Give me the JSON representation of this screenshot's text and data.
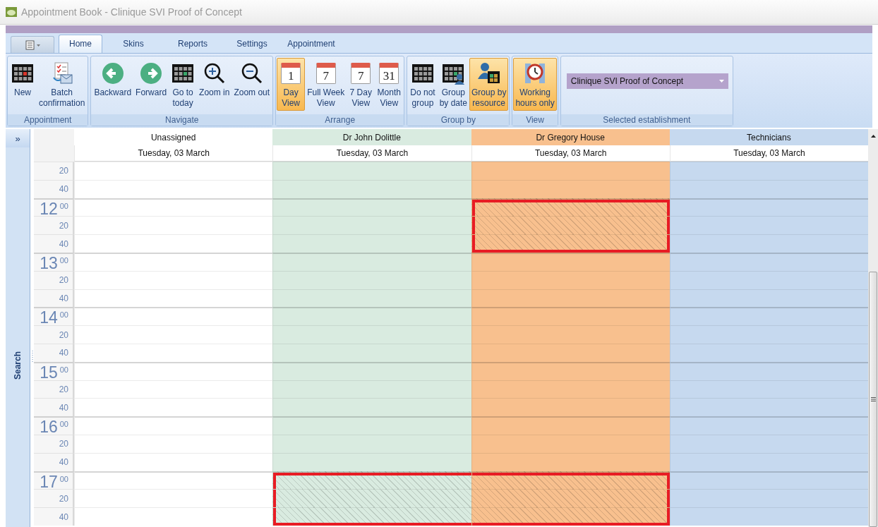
{
  "window": {
    "title": "Appointment Book  - Clinique SVI Proof of Concept"
  },
  "tabs": [
    {
      "label": "Home",
      "selected": true
    },
    {
      "label": "Skins",
      "selected": false
    },
    {
      "label": "Reports",
      "selected": false
    },
    {
      "label": "Settings",
      "selected": false
    },
    {
      "label": "Appointment",
      "selected": false
    }
  ],
  "ribbon": {
    "groups": [
      {
        "caption": "Appointment",
        "kind": "buttons",
        "buttons": [
          {
            "kind": "new",
            "label": "New"
          },
          {
            "kind": "batch",
            "label": "Batch\nconfirmation"
          }
        ]
      },
      {
        "caption": "Navigate",
        "kind": "buttons",
        "buttons": [
          {
            "kind": "back",
            "label": "Backward"
          },
          {
            "kind": "forward",
            "label": "Forward"
          },
          {
            "kind": "today",
            "label": "Go to\ntoday"
          },
          {
            "kind": "zoom-in",
            "label": "Zoom in"
          },
          {
            "kind": "zoom-out",
            "label": "Zoom out"
          }
        ]
      },
      {
        "caption": "Arrange",
        "kind": "buttons",
        "buttons": [
          {
            "kind": "page",
            "icon_text": "1",
            "label": "Day\nView",
            "selected": true
          },
          {
            "kind": "page",
            "icon_text": "7",
            "label": "Full Week\nView",
            "selected": false
          },
          {
            "kind": "page",
            "icon_text": "7",
            "label": "7 Day\nView",
            "selected": false
          },
          {
            "kind": "page",
            "icon_text": "31",
            "label": "Month\nView",
            "selected": false
          }
        ]
      },
      {
        "caption": "Group by",
        "kind": "buttons",
        "buttons": [
          {
            "kind": "no-group",
            "label": "Do not\ngroup",
            "selected": false
          },
          {
            "kind": "by-date",
            "label": "Group\nby date",
            "selected": false
          },
          {
            "kind": "by-resource",
            "label": "Group by\nresource",
            "selected": true
          }
        ]
      },
      {
        "caption": "View",
        "kind": "buttons",
        "buttons": [
          {
            "kind": "hours",
            "label": "Working\nhours only",
            "selected": true
          }
        ]
      },
      {
        "caption": "Selected establishment",
        "kind": "dropdown",
        "value": "Clinique SVI Proof of Concept"
      }
    ]
  },
  "side_pane": {
    "expand_button": "»",
    "label": "Search"
  },
  "calendar": {
    "columns": [
      {
        "name": "Unassigned",
        "date": "Tuesday, 03 March",
        "color": "#ffffff"
      },
      {
        "name": "Dr John Dolittle",
        "date": "Tuesday, 03 March",
        "color": "#d9ebe0"
      },
      {
        "name": "Dr Gregory House",
        "date": "Tuesday, 03 March",
        "color": "#f8c08e"
      },
      {
        "name": "Technicians",
        "date": "Tuesday, 03 March",
        "color": "#c6d9ef"
      }
    ],
    "rows": [
      {
        "minute": "20",
        "cells": [
          {
            "blocked": false
          },
          {
            "blocked": false
          },
          {
            "blocked": false
          },
          {
            "blocked": false
          }
        ]
      },
      {
        "minute": "40",
        "cells": [
          {
            "blocked": false
          },
          {
            "blocked": false
          },
          {
            "blocked": false
          },
          {
            "blocked": false
          }
        ]
      },
      {
        "hour": "12",
        "minute": "00",
        "cells": [
          {
            "blocked": false
          },
          {
            "blocked": false
          },
          {
            "blocked": true
          },
          {
            "blocked": false
          }
        ]
      },
      {
        "minute": "20",
        "cells": [
          {
            "blocked": false
          },
          {
            "blocked": false
          },
          {
            "blocked": true
          },
          {
            "blocked": false
          }
        ]
      },
      {
        "minute": "40",
        "cells": [
          {
            "blocked": false
          },
          {
            "blocked": false
          },
          {
            "blocked": true
          },
          {
            "blocked": false
          }
        ]
      },
      {
        "hour": "13",
        "minute": "00",
        "cells": [
          {
            "blocked": false
          },
          {
            "blocked": false
          },
          {
            "blocked": false
          },
          {
            "blocked": false
          }
        ]
      },
      {
        "minute": "20",
        "cells": [
          {
            "blocked": false
          },
          {
            "blocked": false
          },
          {
            "blocked": false
          },
          {
            "blocked": false
          }
        ]
      },
      {
        "minute": "40",
        "cells": [
          {
            "blocked": false
          },
          {
            "blocked": false
          },
          {
            "blocked": false
          },
          {
            "blocked": false
          }
        ]
      },
      {
        "hour": "14",
        "minute": "00",
        "cells": [
          {
            "blocked": false
          },
          {
            "blocked": false
          },
          {
            "blocked": false
          },
          {
            "blocked": false
          }
        ]
      },
      {
        "minute": "20",
        "cells": [
          {
            "blocked": false
          },
          {
            "blocked": false
          },
          {
            "blocked": false
          },
          {
            "blocked": false
          }
        ]
      },
      {
        "minute": "40",
        "cells": [
          {
            "blocked": false
          },
          {
            "blocked": false
          },
          {
            "blocked": false
          },
          {
            "blocked": false
          }
        ]
      },
      {
        "hour": "15",
        "minute": "00",
        "cells": [
          {
            "blocked": false
          },
          {
            "blocked": false
          },
          {
            "blocked": false
          },
          {
            "blocked": false
          }
        ]
      },
      {
        "minute": "20",
        "cells": [
          {
            "blocked": false
          },
          {
            "blocked": false
          },
          {
            "blocked": false
          },
          {
            "blocked": false
          }
        ]
      },
      {
        "minute": "40",
        "cells": [
          {
            "blocked": false
          },
          {
            "blocked": false
          },
          {
            "blocked": false
          },
          {
            "blocked": false
          }
        ]
      },
      {
        "hour": "16",
        "minute": "00",
        "cells": [
          {
            "blocked": false
          },
          {
            "blocked": false
          },
          {
            "blocked": false
          },
          {
            "blocked": false
          }
        ]
      },
      {
        "minute": "20",
        "cells": [
          {
            "blocked": false
          },
          {
            "blocked": false
          },
          {
            "blocked": false
          },
          {
            "blocked": false
          }
        ]
      },
      {
        "minute": "40",
        "cells": [
          {
            "blocked": false
          },
          {
            "blocked": false
          },
          {
            "blocked": false
          },
          {
            "blocked": false
          }
        ]
      },
      {
        "hour": "17",
        "minute": "00",
        "cells": [
          {
            "blocked": false
          },
          {
            "blocked": true
          },
          {
            "blocked": true
          },
          {
            "blocked": false
          }
        ]
      },
      {
        "minute": "20",
        "cells": [
          {
            "blocked": false
          },
          {
            "blocked": true
          },
          {
            "blocked": true
          },
          {
            "blocked": false
          }
        ]
      },
      {
        "minute": "40",
        "cells": [
          {
            "blocked": false
          },
          {
            "blocked": true
          },
          {
            "blocked": true
          },
          {
            "blocked": false
          }
        ]
      }
    ]
  }
}
